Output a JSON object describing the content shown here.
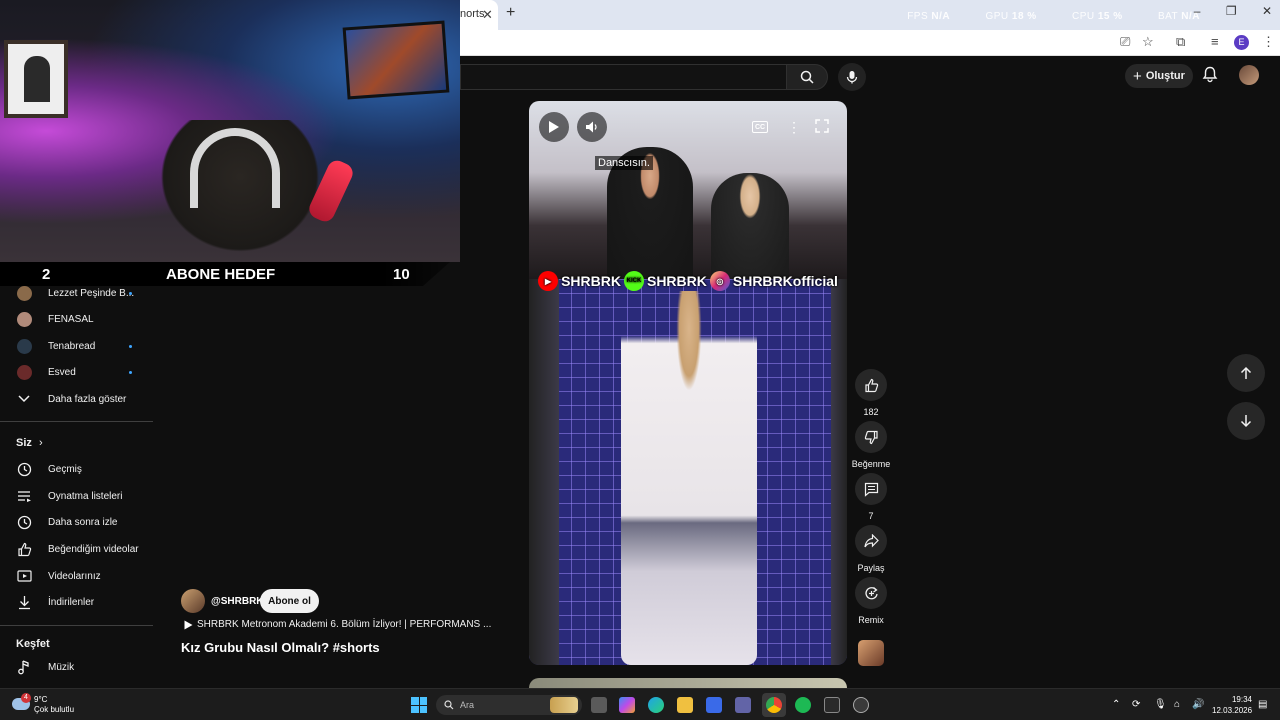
{
  "browser": {
    "tab_title": "norts",
    "stats": {
      "fps_label": "FPS",
      "fps_value": "N/A",
      "gpu_label": "GPU",
      "gpu_value": "18 %",
      "cpu_label": "CPU",
      "cpu_value": "15 %",
      "bat_label": "BAT",
      "bat_value": "N/A"
    },
    "profile_initial": "E"
  },
  "youtube": {
    "create_label": "Oluştur"
  },
  "overlay": {
    "goal_current": "2",
    "goal_label": "ABONE HEDEF",
    "goal_target": "10"
  },
  "sidebar": {
    "subscriptions": [
      {
        "label": "Lezzet Peşinde B...",
        "new": true,
        "color": "#8a6a4a"
      },
      {
        "label": "FENASAL",
        "new": false,
        "color": "#b08a7a"
      },
      {
        "label": "Tenabread",
        "new": true,
        "color": "#2a3a4a"
      },
      {
        "label": "Esved",
        "new": true,
        "color": "#6a2a2a"
      }
    ],
    "show_more": "Daha fazla göster",
    "you_heading": "Siz",
    "you_items": [
      {
        "label": "Geçmiş",
        "icon": "history-icon"
      },
      {
        "label": "Oynatma listeleri",
        "icon": "playlists-icon"
      },
      {
        "label": "Daha sonra izle",
        "icon": "watch-later-icon"
      },
      {
        "label": "Beğendiğim videolar",
        "icon": "liked-videos-icon"
      },
      {
        "label": "Videolarınız",
        "icon": "your-videos-icon"
      },
      {
        "label": "İndirilenler",
        "icon": "downloads-icon"
      }
    ],
    "explore_heading": "Keşfet",
    "explore_items": [
      {
        "label": "Müzik",
        "icon": "music-icon"
      }
    ]
  },
  "short": {
    "caption": "Danscısın.",
    "socials": [
      "SHRBRK",
      "SHRBRK",
      "SHRBRKofficial"
    ],
    "kick_label": "KICK",
    "channel": "@SHRBRK",
    "subscribe": "Abone ol",
    "linked_video": "SHRBRK Metronom Akademi 6. Bölüm İzliyor! | PERFORMANS ...",
    "title": "Kız Grubu Nasıl Olmalı? #shorts",
    "actions": {
      "like_count": "182",
      "dislike_label": "Beğenme",
      "comment_count": "7",
      "share_label": "Paylaş",
      "remix_label": "Remix"
    }
  },
  "taskbar": {
    "weather_temp": "9°C",
    "weather_desc": "Çok bulutlu",
    "weather_badge": "4",
    "search_placeholder": "Ara",
    "time": "19:34",
    "date": "12.03.2026"
  }
}
